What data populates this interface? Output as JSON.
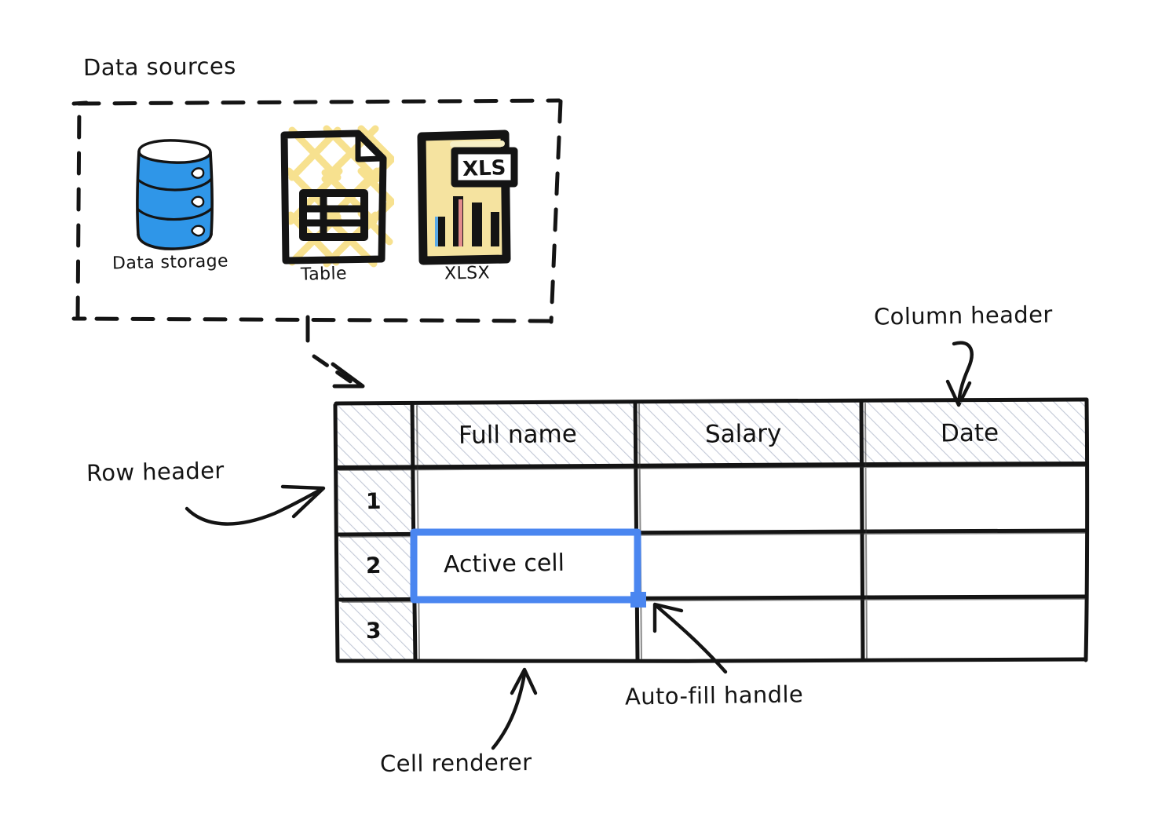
{
  "diagram": {
    "title": "Data sources",
    "style": "hand-drawn sketch"
  },
  "data_sources": {
    "title": "Data sources",
    "items": [
      {
        "id": "data-storage",
        "label": "Data storage",
        "icon": "database-cylinder-icon",
        "color": "#2f96e8"
      },
      {
        "id": "table",
        "label": "Table",
        "icon": "table-document-icon",
        "color": "#111111",
        "accent": "#f7e08a"
      },
      {
        "id": "xlsx",
        "label": "XLSX",
        "icon": "xlsx-file-icon",
        "color": "#f5e3a0",
        "badge": "XLS"
      }
    ]
  },
  "annotations": {
    "column_header": "Column header",
    "row_header": "Row header",
    "auto_fill_handle": "Auto-fill handle",
    "cell_renderer": "Cell renderer"
  },
  "spreadsheet": {
    "columns": [
      "Full name",
      "Salary",
      "Date"
    ],
    "rows": [
      {
        "header": "1",
        "cells": [
          "",
          "",
          ""
        ]
      },
      {
        "header": "2",
        "cells": [
          "Active cell",
          "",
          ""
        ]
      },
      {
        "header": "3",
        "cells": [
          "",
          "",
          ""
        ]
      }
    ],
    "active_cell": {
      "label": "Active cell",
      "row": "2",
      "column": "Full name",
      "border_color": "#4a86f0",
      "handle_color": "#4a86f0"
    },
    "header_fill": "hatched",
    "header_hatch_color": "#c2c8d6"
  },
  "colors": {
    "ink": "#141414",
    "accent_blue": "#4a86f0",
    "database_blue": "#2f96e8",
    "xlsx_yellow": "#f5e3a0",
    "hatch_gray": "#c2c8d6"
  }
}
